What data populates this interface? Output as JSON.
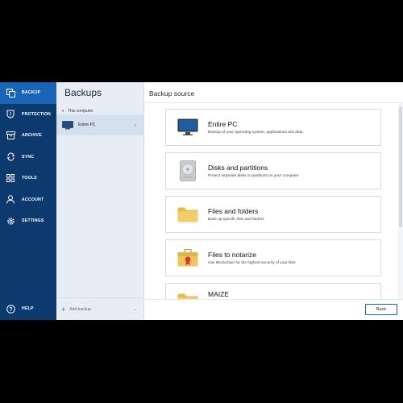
{
  "nav": {
    "items": [
      {
        "label": "BACKUP",
        "icon": "backup-icon"
      },
      {
        "label": "PROTECTION",
        "icon": "shield-icon"
      },
      {
        "label": "ARCHIVE",
        "icon": "archive-icon"
      },
      {
        "label": "SYNC",
        "icon": "sync-icon"
      },
      {
        "label": "TOOLS",
        "icon": "tools-icon"
      },
      {
        "label": "ACCOUNT",
        "icon": "account-icon"
      },
      {
        "label": "SETTINGS",
        "icon": "gear-icon"
      }
    ],
    "help": {
      "label": "HELP",
      "icon": "help-icon"
    }
  },
  "backups": {
    "title": "Backups",
    "group_label": "This computer",
    "items": [
      {
        "label": "Entire PC",
        "icon": "monitor-icon"
      }
    ],
    "add_label": "Add backup"
  },
  "main": {
    "title": "Backup source",
    "sources": [
      {
        "title": "Entire PC",
        "desc": "Backup of your operating system, applications ans data.",
        "icon": "monitor-icon"
      },
      {
        "title": "Disks and partitions",
        "desc": "Protect separate disks or partitions on your computer",
        "icon": "disk-icon"
      },
      {
        "title": "Files and folders",
        "desc": "Back up specific files and folders",
        "icon": "folder-icon"
      },
      {
        "title": "Files to notarize",
        "desc": "Use Blockchain for the highest security of your files",
        "icon": "notarize-briefcase-icon"
      },
      {
        "title": "MAIZE",
        "desc": "",
        "icon": "folder-icon"
      }
    ],
    "back_label": "Back"
  },
  "colors": {
    "nav_bg": "#0c3a6e",
    "nav_active": "#1a64b8",
    "mid_bg": "#e8edf5",
    "accent": "#1a64b8"
  }
}
